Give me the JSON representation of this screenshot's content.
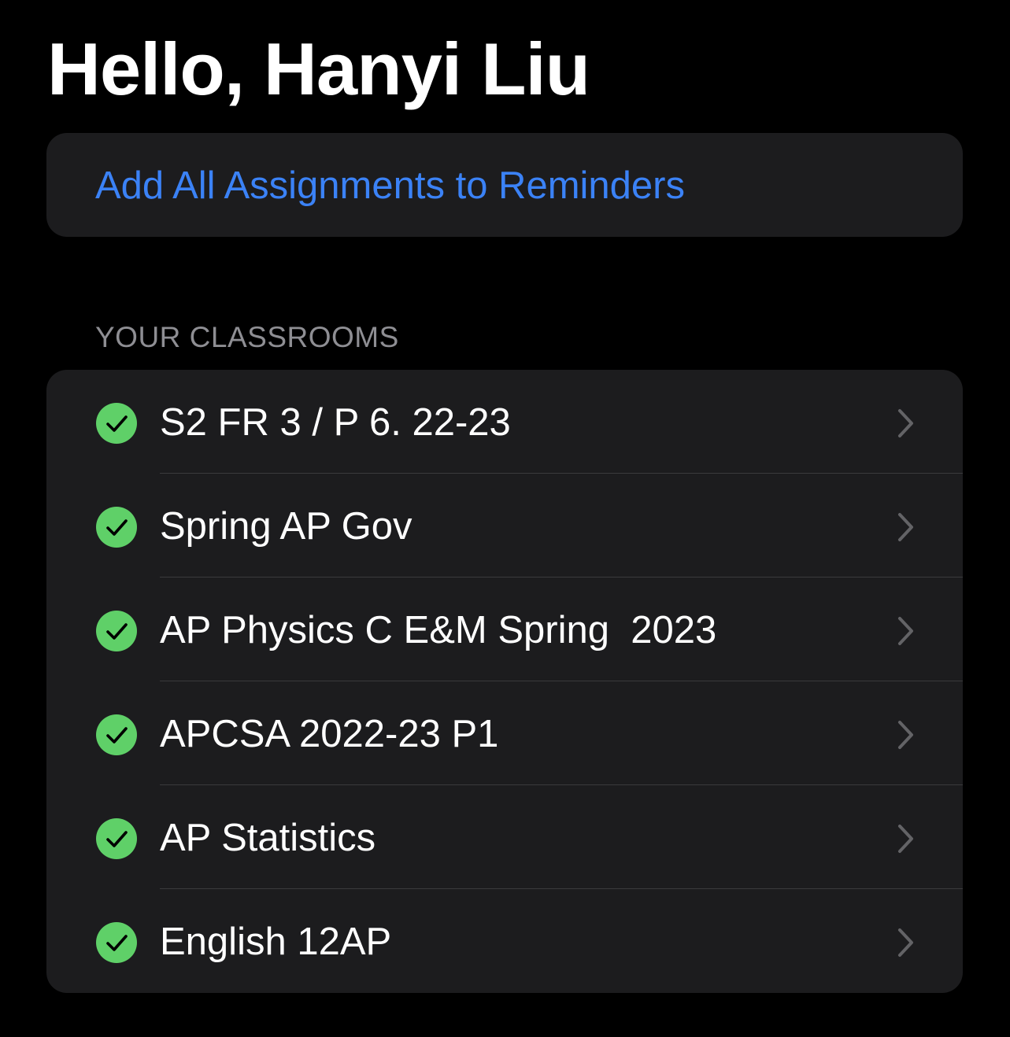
{
  "greeting": "Hello, Hanyi Liu",
  "actions": {
    "add_all_label": "Add All Assignments to Reminders"
  },
  "classrooms": {
    "header": "YOUR CLASSROOMS",
    "items": [
      {
        "name": "S2 FR 3 / P 6. 22-23",
        "status": "checked"
      },
      {
        "name": "Spring AP Gov",
        "status": "checked"
      },
      {
        "name": "AP Physics C E&M Spring  2023",
        "status": "checked"
      },
      {
        "name": "APCSA 2022-23 P1",
        "status": "checked"
      },
      {
        "name": "AP Statistics",
        "status": "checked"
      },
      {
        "name": "English 12AP",
        "status": "checked"
      }
    ]
  },
  "icons": {
    "status": "checkmark-circle-icon",
    "disclosure": "chevron-right-icon"
  },
  "colors": {
    "background": "#000000",
    "card": "#1c1c1e",
    "accent": "#3b82f6",
    "success": "#5fd068",
    "secondary_text": "#8e8e93",
    "separator": "#3a3a3c"
  }
}
